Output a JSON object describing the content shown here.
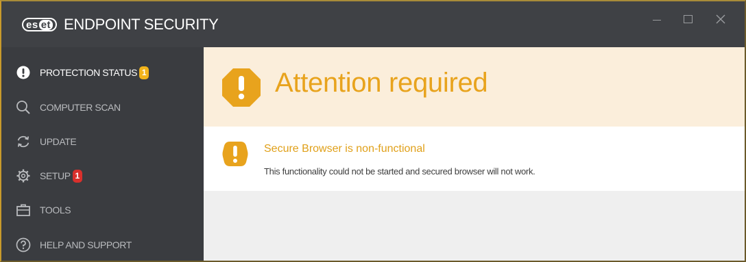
{
  "window": {
    "logo_mark": "es",
    "logo_mark_inv": "et",
    "title": "ENDPOINT SECURITY",
    "controls": {
      "minimize": "minimize",
      "maximize": "maximize",
      "close": "×"
    }
  },
  "sidebar": {
    "items": [
      {
        "label": "PROTECTION STATUS",
        "icon": "exclamation-circle-icon",
        "badge": "1",
        "badge_color": "#f2b31a",
        "active": true
      },
      {
        "label": "COMPUTER SCAN",
        "icon": "search-icon",
        "active": false
      },
      {
        "label": "UPDATE",
        "icon": "refresh-icon",
        "active": false
      },
      {
        "label": "SETUP",
        "icon": "gear-icon",
        "badge": "1",
        "badge_color": "#d9302c",
        "active": false
      },
      {
        "label": "TOOLS",
        "icon": "briefcase-icon",
        "active": false
      },
      {
        "label": "HELP AND SUPPORT",
        "icon": "question-circle-icon",
        "active": false
      }
    ]
  },
  "main": {
    "banner": {
      "title": "Attention required",
      "icon": "warning-octagon-icon",
      "color": "#e8a31d"
    },
    "alert": {
      "title": "Secure Browser is non-functional",
      "description": "This functionality could not be started and secured browser will not work.",
      "icon": "warning-badge-icon",
      "color": "#e0a019"
    }
  }
}
